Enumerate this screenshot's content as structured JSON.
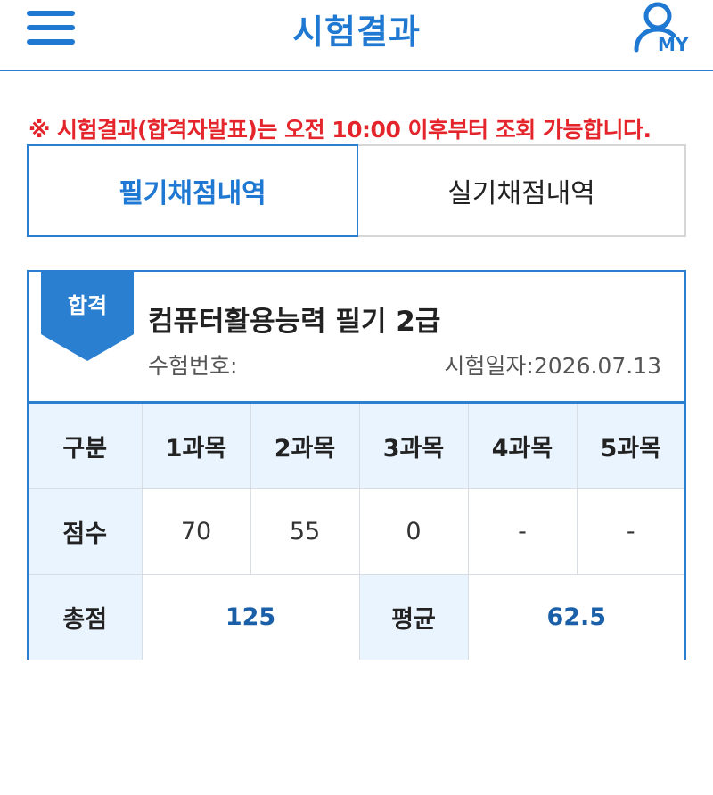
{
  "header": {
    "title": "시험결과",
    "my_label": "MY"
  },
  "notice": "※ 시험결과(합격자발표)는 오전 10:00 이후부터 조회 가능합니다.",
  "tabs": [
    {
      "label": "필기채점내역",
      "active": true
    },
    {
      "label": "실기채점내역",
      "active": false
    }
  ],
  "result": {
    "badge": "합격",
    "exam_name": "컴퓨터활용능력 필기 2급",
    "exam_no_label": "수험번호:",
    "exam_date_label": "시험일자:",
    "exam_date": "2026.07.13"
  },
  "table": {
    "header_label": "구분",
    "subjects": [
      "1과목",
      "2과목",
      "3과목",
      "4과목",
      "5과목"
    ],
    "score_label": "점수",
    "scores": [
      "70",
      "55",
      "0",
      "-",
      "-"
    ],
    "total_label": "총점",
    "total_value": "125",
    "average_label": "평균",
    "average_value": "62.5"
  },
  "colors": {
    "accent": "#1f78d1",
    "notice": "#e4252b",
    "header_bg": "#eaf4ff",
    "value_text": "#1a5fa8"
  }
}
